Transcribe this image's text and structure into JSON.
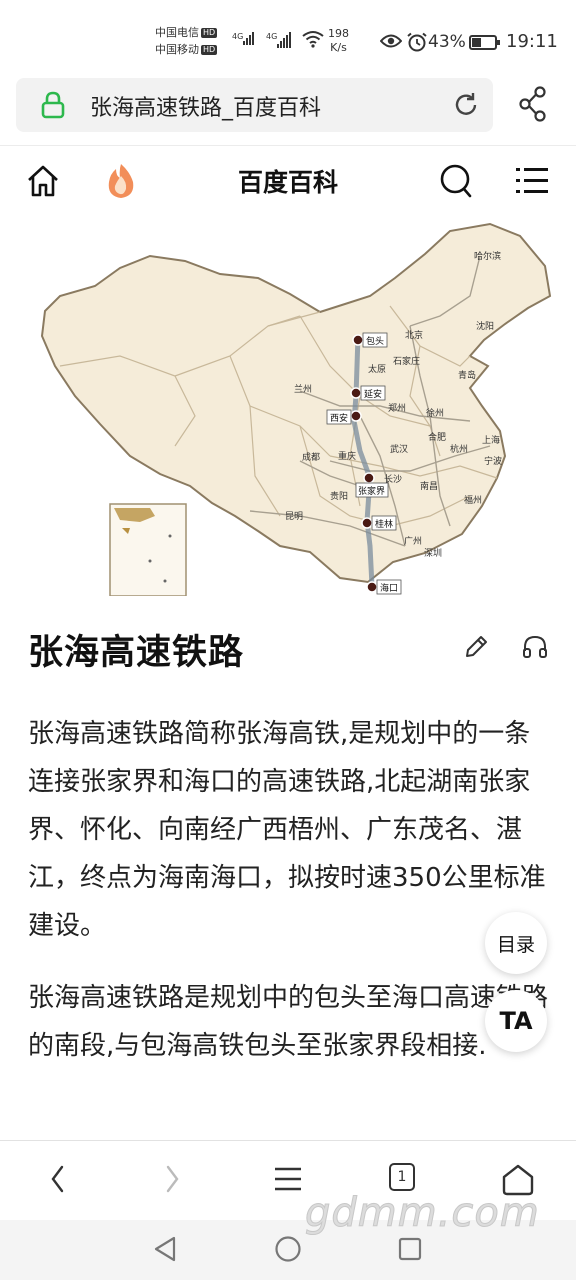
{
  "status_bar": {
    "carrier1": "中国电信",
    "carrier2": "中国移动",
    "hd": "HD",
    "net1": "4G",
    "net2": "4G",
    "speed_value": "198",
    "speed_unit": "K/s",
    "battery_percent": "43%",
    "battery_level": 0.43,
    "time": "19:11"
  },
  "browser": {
    "url_text": "张海高速铁路_百度百科"
  },
  "header": {
    "title": "百度百科"
  },
  "map": {
    "stations": [
      "包头",
      "延安",
      "西安",
      "张家界",
      "桂林",
      "海口"
    ],
    "cities": [
      "哈尔滨",
      "沈阳",
      "北京",
      "石家庄",
      "太原",
      "青岛",
      "兰州",
      "郑州",
      "徐州",
      "上海",
      "杭州",
      "宁波",
      "武汉",
      "合肥",
      "成都",
      "重庆",
      "长沙",
      "南昌",
      "贵阳",
      "福州",
      "昆明",
      "广州",
      "深圳"
    ]
  },
  "article": {
    "title": "张海高速铁路",
    "paragraph1": "张海高速铁路简称张海高铁,是规划中的一条连接张家界和海口的高速铁路,北起湖南张家界、怀化、向南经广西梧州、广东茂名、湛江，终点为海南海口，拟按时速350公里标准建设。",
    "paragraph2": "张海高速铁路是规划中的包头至海口高速铁路的南段,与包海高铁包头至张家界段相接."
  },
  "floating": {
    "toc_label": "目录",
    "ta_label": "TA"
  },
  "toolbar": {
    "tab_count": "1"
  },
  "watermark": "gdmm.com",
  "colors": {
    "lock_green": "#2db84d",
    "flame_orange": "#f07a3c",
    "map_land": "#f5ecd9",
    "rail_line": "#8f8f8f"
  }
}
